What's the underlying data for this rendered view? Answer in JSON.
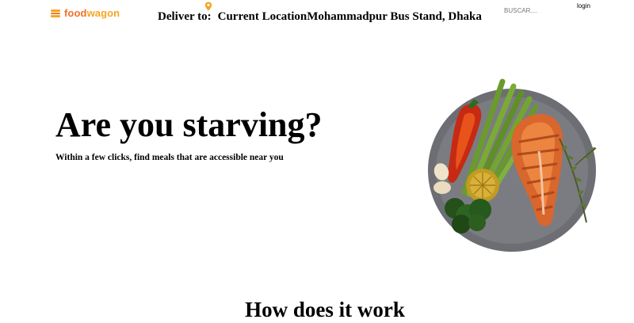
{
  "brand": {
    "name_part1": "food",
    "name_part2": "wagon",
    "primary_color": "#f17228",
    "secondary_color": "#f5a623",
    "icon": "food-truck-icon"
  },
  "header": {
    "deliver_label": "Deliver to:",
    "location": "Current LocationMohammadpur Bus Stand, Dhaka",
    "location_icon": "map-pin-icon",
    "search_placeholder": "BUSCAR....",
    "login_label": "login"
  },
  "hero": {
    "title": "Are you starving?",
    "subtitle": "Within a few clicks, find meals that are accessible near you",
    "image": "salmon-plate-image"
  },
  "section": {
    "title": "How does it work"
  }
}
